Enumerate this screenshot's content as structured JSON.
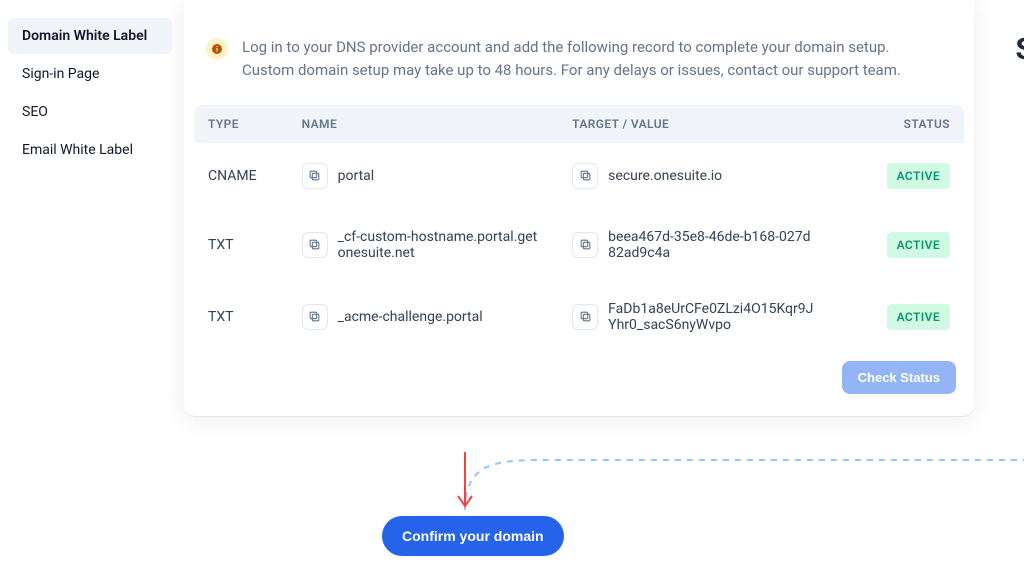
{
  "sidebar": {
    "items": [
      {
        "label": "Domain White Label",
        "name": "sidebar-item-domain-white-label",
        "active": true
      },
      {
        "label": "Sign-in Page",
        "name": "sidebar-item-sign-in-page",
        "active": false
      },
      {
        "label": "SEO",
        "name": "sidebar-item-seo",
        "active": false
      },
      {
        "label": "Email White Label",
        "name": "sidebar-item-email-white-label",
        "active": false
      }
    ]
  },
  "info": {
    "text": "Log in to your DNS provider account and add the following record to complete your domain setup. Custom domain setup may take up to 48 hours. For any delays or issues, contact our support team."
  },
  "table": {
    "headers": {
      "type": "TYPE",
      "name": "NAME",
      "target": "TARGET / VALUE",
      "status": "STATUS"
    },
    "rows": [
      {
        "type": "CNAME",
        "name": "portal",
        "target": "secure.onesuite.io",
        "status": "ACTIVE"
      },
      {
        "type": "TXT",
        "name": "_cf-custom-hostname.portal.getonesuite.net",
        "target": "beea467d-35e8-46de-b168-027d82ad9c4a",
        "status": "ACTIVE"
      },
      {
        "type": "TXT",
        "name": "_acme-challenge.portal",
        "target": "FaDb1a8eUrCFe0ZLzi4O15Kqr9JYhr0_sacS6nyWvpo",
        "status": "ACTIVE"
      }
    ]
  },
  "buttons": {
    "check_status": "Check Status",
    "confirm": "Confirm your domain"
  },
  "floating_right_letter": "S"
}
